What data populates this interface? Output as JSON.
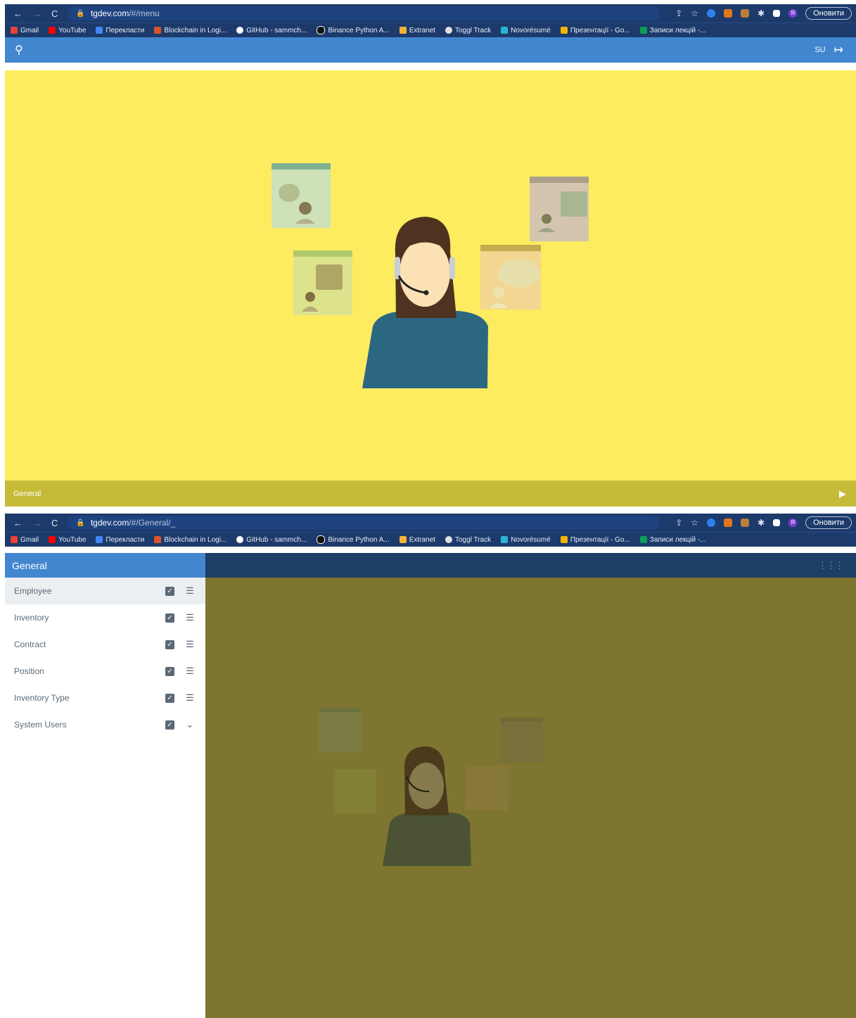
{
  "browser": {
    "nav": [
      "←",
      "→",
      "C"
    ],
    "update_label": "Оновити",
    "profile_letter": "Я",
    "bookmarks": [
      {
        "label": "Gmail",
        "color": "#ea4335"
      },
      {
        "label": "YouTube",
        "color": "#ff0000"
      },
      {
        "label": "Перекласти",
        "color": "#4285f4"
      },
      {
        "label": "Blockchain in Logi...",
        "color": "#d9542b"
      },
      {
        "label": "GitHub - sammch...",
        "color": "#ffffff"
      },
      {
        "label": "Binance Python A...",
        "color": "#222222"
      },
      {
        "label": "Extranet",
        "color": "#f2b23a"
      },
      {
        "label": "Toggl Track",
        "color": "#e0e0e0"
      },
      {
        "label": "Novorésumé",
        "color": "#2bb3d6"
      },
      {
        "label": "Презентації - Go...",
        "color": "#f4b400"
      },
      {
        "label": "Записи лекцій -...",
        "color": "#0f9d58"
      }
    ]
  },
  "screen1": {
    "host": "tgdev.com",
    "path": "/#/menu",
    "user_initials": "SU",
    "hero_footer_label": "General"
  },
  "screen2": {
    "host": "tgdev.com",
    "path": "/#/General/_",
    "sidebar_title": "General",
    "menu_items": [
      {
        "label": "Employee",
        "selected": true,
        "action_icon": "list-icon"
      },
      {
        "label": "Inventory",
        "selected": false,
        "action_icon": "list-icon"
      },
      {
        "label": "Contract",
        "selected": false,
        "action_icon": "list-icon"
      },
      {
        "label": "Position",
        "selected": false,
        "action_icon": "list-icon"
      },
      {
        "label": "Inventory Type",
        "selected": false,
        "action_icon": "list-icon"
      },
      {
        "label": "System Users",
        "selected": false,
        "action_icon": "chevron-down-icon"
      }
    ]
  },
  "colors": {
    "chrome": "#1c3a6b",
    "appbar": "#4286d0",
    "hero": "#fdec5f",
    "hero_footer": "#c6bb39",
    "main_overlay": "#7e7530"
  }
}
